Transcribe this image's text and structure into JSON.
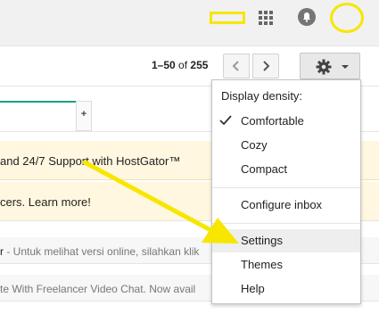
{
  "header": {
    "annotation_color": "#f6e600",
    "icons": [
      "apps-grid-icon",
      "notifications-bell-icon"
    ]
  },
  "toolbar": {
    "range": "1–50",
    "of_label": "of",
    "total": "255",
    "icons": [
      "chevron-left-icon",
      "chevron-right-icon",
      "gear-icon",
      "caret-down-icon"
    ]
  },
  "tabs": {
    "add_label": "+",
    "accent_color": "#16a085"
  },
  "emails": {
    "ads": [
      {
        "text": "and 24/7 Support with HostGator™"
      },
      {
        "text": "cers. Learn more!"
      }
    ],
    "rows": [
      {
        "sender_tail": "r",
        "snippet": " - Untuk melihat versi online, silahkan klik"
      },
      {
        "sender_tail": "",
        "snippet": "te With Freelancer Video Chat. Now avail"
      }
    ]
  },
  "settings_menu": {
    "header": "Display density:",
    "density_options": [
      {
        "label": "Comfortable",
        "checked": true
      },
      {
        "label": "Cozy",
        "checked": false
      },
      {
        "label": "Compact",
        "checked": false
      }
    ],
    "configure_inbox": "Configure inbox",
    "settings": "Settings",
    "themes": "Themes",
    "help": "Help",
    "highlighted_item": "Settings"
  },
  "annotation_arrow": {
    "color": "#f6e600",
    "points_to": "Settings"
  }
}
